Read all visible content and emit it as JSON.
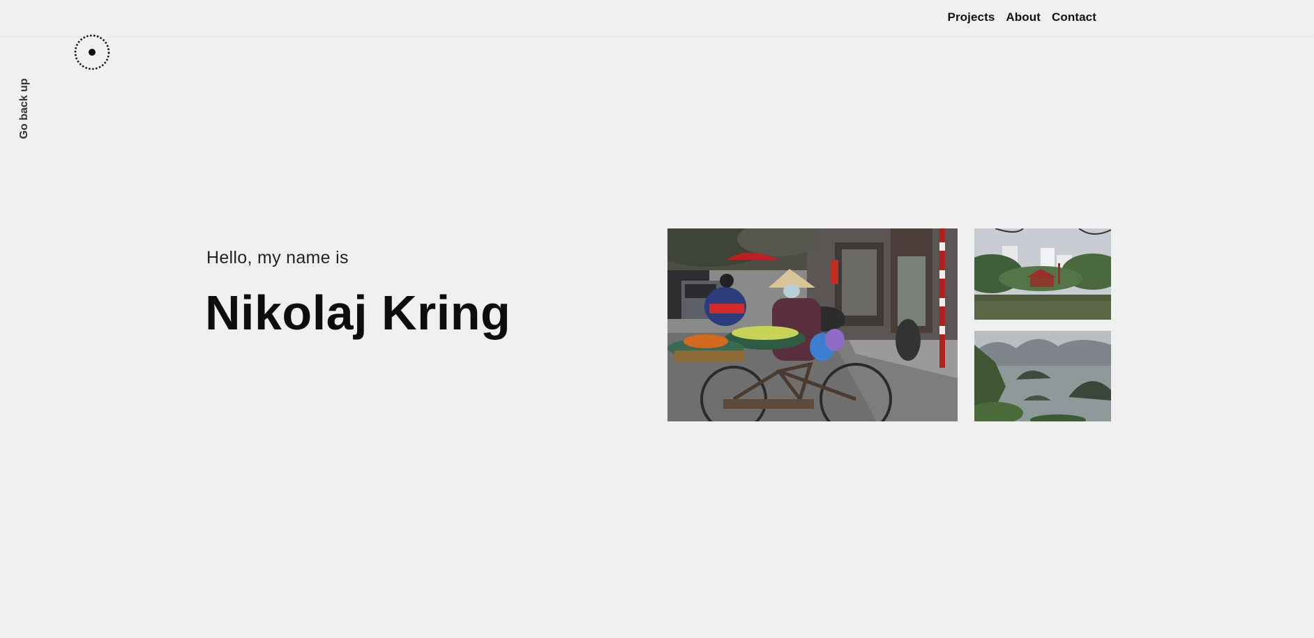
{
  "nav": {
    "items": [
      {
        "label": "Projects"
      },
      {
        "label": "About"
      },
      {
        "label": "Contact"
      }
    ]
  },
  "logo": {
    "icon": "dotted-circle-logo-icon"
  },
  "sidebar": {
    "go_back_label": "Go back up"
  },
  "hero": {
    "greeting": "Hello, my name is",
    "name": "Nikolaj Kring"
  },
  "gallery": {
    "photos": [
      {
        "subject": "street vendor with bicycle"
      },
      {
        "subject": "temple on lake"
      },
      {
        "subject": "limestone islands in bay"
      }
    ]
  },
  "colors": {
    "background": "#f0f0f0",
    "text": "#111111"
  }
}
